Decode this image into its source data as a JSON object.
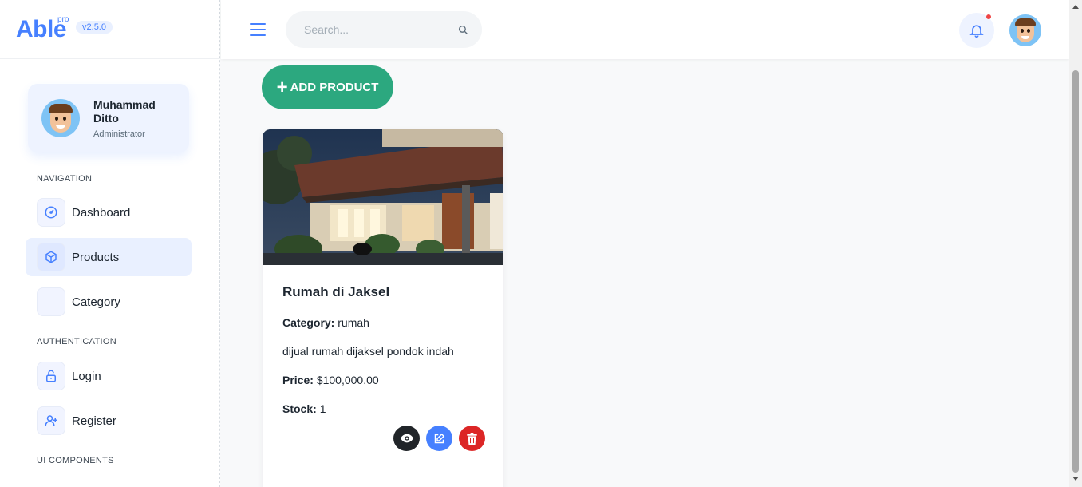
{
  "brand": {
    "name": "Able",
    "badge": "pro",
    "version": "v2.5.0"
  },
  "user": {
    "name": "Muhammad Ditto",
    "role": "Administrator"
  },
  "nav": {
    "caption_navigation": "NAVIGATION",
    "caption_authentication": "AUTHENTICATION",
    "caption_ui": "UI COMPONENTS",
    "items": [
      {
        "label": "Dashboard",
        "icon": "gauge-icon"
      },
      {
        "label": "Products",
        "icon": "box-icon",
        "active": true
      },
      {
        "label": "Category",
        "icon": "blank-icon"
      },
      {
        "label": "Login",
        "icon": "lock-icon"
      },
      {
        "label": "Register",
        "icon": "user-plus-icon"
      }
    ]
  },
  "header": {
    "search_placeholder": "Search..."
  },
  "main": {
    "add_button_label": "ADD PRODUCT"
  },
  "product": {
    "title": "Rumah di Jaksel",
    "category_label": "Category:",
    "category_value": "rumah",
    "description": "dijual rumah dijaksel pondok indah",
    "price_label": "Price:",
    "price_value": "$100,000.00",
    "stock_label": "Stock:",
    "stock_value": "1"
  },
  "colors": {
    "primary": "#4680ff",
    "success": "#2ca87f",
    "danger": "#dc2626",
    "dark": "#212529"
  }
}
